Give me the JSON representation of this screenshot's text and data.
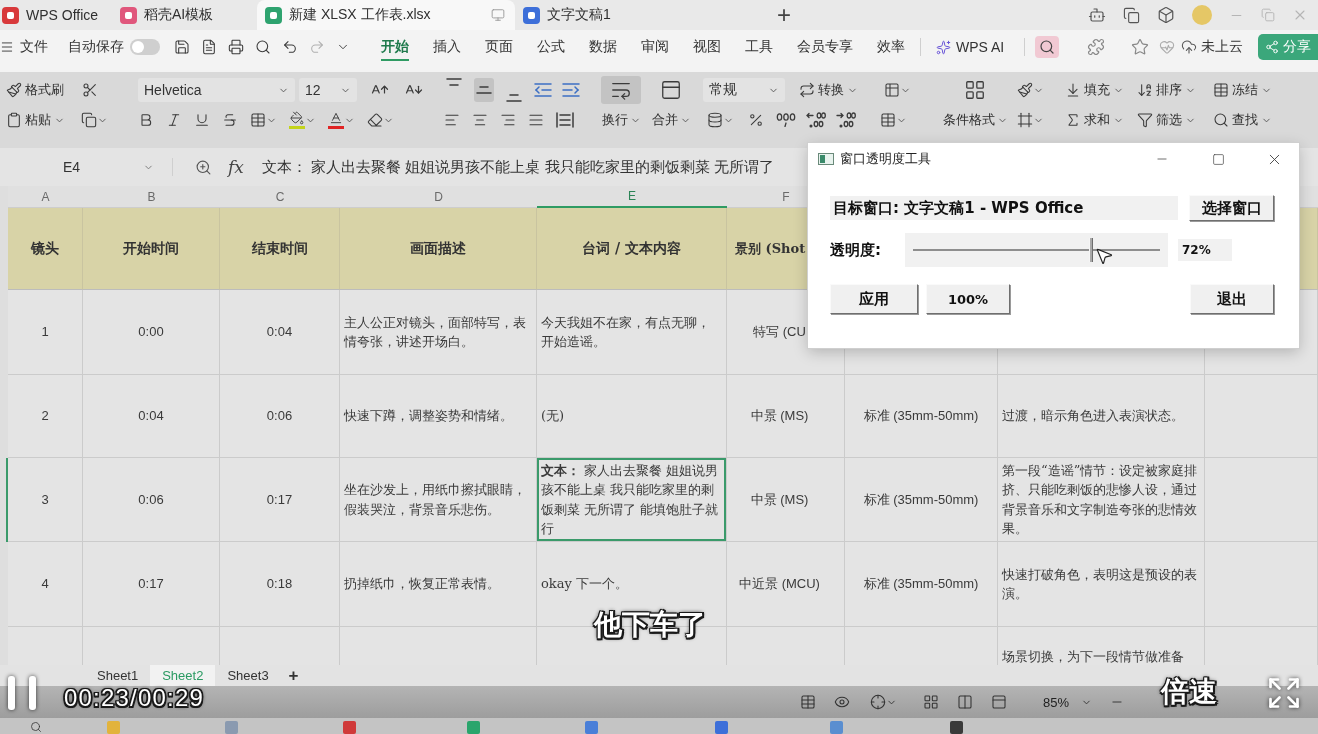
{
  "browser_tabs": [
    {
      "kind": "wps",
      "label": "WPS Office",
      "selected": false
    },
    {
      "kind": "docer",
      "label": "稻壳AI模板",
      "selected": false
    },
    {
      "kind": "sheet",
      "label": "新建 XLSX 工作表.xlsx",
      "selected": true
    },
    {
      "kind": "writer",
      "label": "文字文稿1",
      "selected": false
    }
  ],
  "new_tab": "+",
  "menu": {
    "file": "文件",
    "autosave": {
      "label": "自动保存",
      "on": false
    },
    "tabs": [
      {
        "label": "开始",
        "selected": true
      },
      {
        "label": "插入",
        "selected": false
      },
      {
        "label": "页面",
        "selected": false
      },
      {
        "label": "公式",
        "selected": false
      },
      {
        "label": "数据",
        "selected": false
      },
      {
        "label": "审阅",
        "selected": false
      },
      {
        "label": "视图",
        "selected": false
      },
      {
        "label": "工具",
        "selected": false
      },
      {
        "label": "会员专享",
        "selected": false
      },
      {
        "label": "效率",
        "selected": false
      }
    ],
    "ai": "WPS AI",
    "cloud": "未上云",
    "share": "分享"
  },
  "ribbon": {
    "format_painter": "格式刷",
    "paste": "粘贴",
    "font_family": "Helvetica",
    "font_size": "12",
    "valign": [
      {
        "kind": "top",
        "selected": false
      },
      {
        "kind": "middle",
        "selected": true
      },
      {
        "kind": "bottom",
        "selected": false
      }
    ],
    "wrap": {
      "label": "换行",
      "on": true
    },
    "merge": "合并",
    "number_format": "常规",
    "convert": "转换",
    "conditional_format": "条件格式",
    "editing": [
      {
        "kind": "fill",
        "label": "填充"
      },
      {
        "kind": "sort",
        "label": "排序"
      },
      {
        "kind": "freeze",
        "label": "冻结"
      },
      {
        "kind": "sum",
        "label": "求和"
      },
      {
        "kind": "filter",
        "label": "筛选"
      },
      {
        "kind": "find",
        "label": "查找"
      }
    ]
  },
  "formula_bar": {
    "cell": "E4",
    "fx": "fx",
    "formula": "文本： 家人出去聚餐 姐姐说男孩不能上桌 我只能吃家里的剩饭剩菜 无所谓了"
  },
  "sheet": {
    "columns": [
      {
        "label": "A",
        "selected": false
      },
      {
        "label": "B",
        "selected": false
      },
      {
        "label": "C",
        "selected": false
      },
      {
        "label": "D",
        "selected": false
      },
      {
        "label": "E",
        "selected": true
      },
      {
        "label": "F",
        "selected": false
      }
    ],
    "header": [
      "镜头",
      "开始时间",
      "结束时间",
      "画面描述",
      "台词 / 文本内容",
      "景别 (Shot"
    ],
    "rows": [
      {
        "selected": false,
        "cells": {
          "A": "1",
          "B": "0:00",
          "C": "0:04",
          "D": "主人公正对镜头，面部特写，表情夸张，讲述开场白。",
          "E": "今天我姐不在家，有点无聊，开始造谣。",
          "F": "特写 (CU"
        }
      },
      {
        "selected": false,
        "cells": {
          "A": "2",
          "B": "0:04",
          "C": "0:06",
          "D": "快速下蹲，调整姿势和情绪。",
          "E": "(无)",
          "F": "中景 (MS)",
          "G": "标准 (35mm-50mm)",
          "H": "过渡，暗示角色进入表演状态。"
        }
      },
      {
        "selected": true,
        "cells": {
          "A": "3",
          "B": "0:06",
          "C": "0:17",
          "D": "坐在沙发上，用纸巾擦拭眼睛，假装哭泣，背景音乐悲伤。",
          "E": "**文本：** 家人出去聚餐 姐姐说男孩不能上桌 我只能吃家里的剩饭剩菜 无所谓了 能填饱肚子就行",
          "F": "中景 (MS)",
          "G": "标准 (35mm-50mm)",
          "H": "第一段“造谣”情节：设定被家庭排挤、只能吃剩饭的悲惨人设，通过背景音乐和文字制造夸张的悲情效果。"
        }
      },
      {
        "selected": false,
        "cells": {
          "A": "4",
          "B": "0:17",
          "C": "0:18",
          "D": "扔掉纸巾，恢复正常表情。",
          "E": "okay 下一个。",
          "F": "中近景 (MCU)",
          "G": "标准 (35mm-50mm)",
          "H": "快速打破角色，表明这是预设的表演。"
        }
      },
      {
        "selected": false,
        "cells": {
          "H": "场景切换，为下一段情节做准备"
        }
      }
    ]
  },
  "sheet_tabs": [
    {
      "label": "Sheet1",
      "selected": false
    },
    {
      "label": "Sheet2",
      "selected": true
    },
    {
      "label": "Sheet3",
      "selected": false
    }
  ],
  "add_sheet": "+",
  "status": {
    "zoom": "85%"
  },
  "dialog": {
    "title": "窗口透明度工具",
    "target": "目标窗口: 文字文稿1 - WPS Office",
    "choose": "选择窗口",
    "opacity": {
      "label": "透明度:",
      "level": 0.72,
      "reading": "72%"
    },
    "buttons": [
      {
        "kind": "apply",
        "label": "应用"
      },
      {
        "kind": "reset",
        "label": "100%"
      },
      {
        "kind": "exit",
        "label": "退出"
      }
    ]
  },
  "video": {
    "paused": false,
    "time": "00:23/00:29",
    "speed": "倍速",
    "subtitle": "他下车了"
  }
}
